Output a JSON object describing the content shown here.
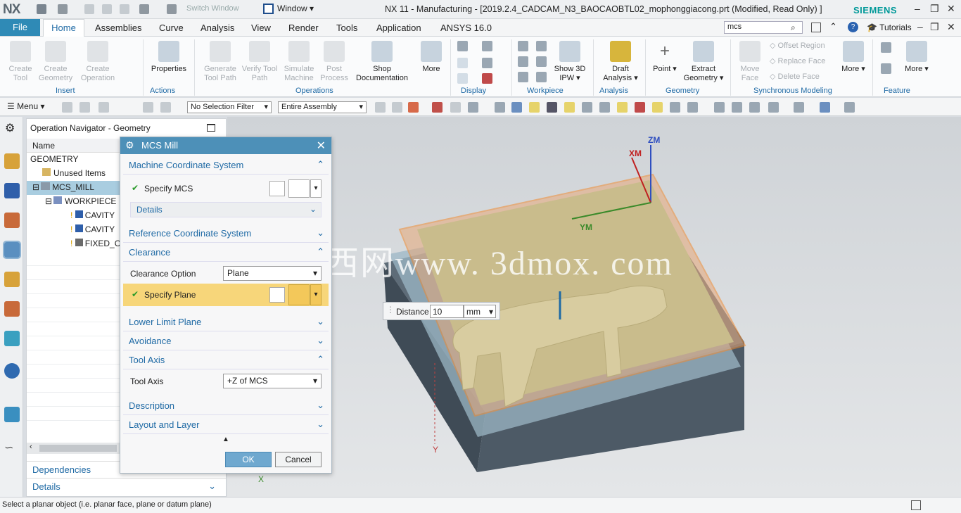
{
  "app": {
    "logo": "NX",
    "title": "NX 11 - Manufacturing - [2019.2.4_CADCAM_N3_BAOCAOBTL02_mophonggiacong.prt (Modified, Read Only) ]",
    "brand": "SIEMENS",
    "switch_window": "Switch Window",
    "window_menu": "Window"
  },
  "menu": {
    "file": "File",
    "tabs": [
      "Home",
      "Assemblies",
      "Curve",
      "Analysis",
      "View",
      "Render",
      "Tools",
      "Application",
      "ANSYS 16.0"
    ],
    "search": "mcs",
    "tutorials": "Tutorials"
  },
  "ribbon": {
    "buttons": [
      {
        "label": "Create Tool"
      },
      {
        "label": "Create Geometry"
      },
      {
        "label": "Create Operation"
      },
      {
        "label": "Properties"
      },
      {
        "label": "Generate Tool Path"
      },
      {
        "label": "Verify Tool Path"
      },
      {
        "label": "Simulate Machine"
      },
      {
        "label": "Post Process"
      },
      {
        "label": "Shop Documentation"
      },
      {
        "label": "More"
      },
      {
        "label": "Show 3D IPW"
      },
      {
        "label": "Draft Analysis"
      },
      {
        "label": "Point"
      },
      {
        "label": "Extract Geometry"
      },
      {
        "label": "Move Face"
      },
      {
        "label": "Offset Region"
      },
      {
        "label": "Replace Face"
      },
      {
        "label": "Delete Face"
      },
      {
        "label": "More"
      },
      {
        "label": "More"
      }
    ],
    "groups": [
      "Insert",
      "Actions",
      "Operations",
      "Display",
      "Workpiece",
      "Analysis",
      "Geometry",
      "Synchronous Modeling",
      "Feature"
    ]
  },
  "toolbar": {
    "menu": "Menu",
    "selection_filter": "No Selection Filter",
    "assembly": "Entire Assembly"
  },
  "navigator": {
    "title": "Operation Navigator - Geometry",
    "column": "Name",
    "items": [
      "GEOMETRY",
      "Unused Items",
      "MCS_MILL",
      "WORKPIECE",
      "CAVITY",
      "CAVITY",
      "FIXED_C"
    ],
    "dependencies": "Dependencies",
    "details": "Details"
  },
  "dialog": {
    "title": "MCS Mill",
    "sections": {
      "mcs": "Machine Coordinate System",
      "specify_mcs": "Specify MCS",
      "details": "Details",
      "rcs": "Reference Coordinate System",
      "clearance": "Clearance",
      "clearance_option_label": "Clearance Option",
      "clearance_option_value": "Plane",
      "specify_plane": "Specify Plane",
      "lower_limit": "Lower Limit Plane",
      "avoidance": "Avoidance",
      "tool_axis": "Tool Axis",
      "tool_axis_label": "Tool Axis",
      "tool_axis_value": "+Z of MCS",
      "description": "Description",
      "layout": "Layout and Layer"
    },
    "ok": "OK",
    "cancel": "Cancel"
  },
  "viewport": {
    "distance_label": "Distance",
    "distance_value": "10",
    "distance_unit": "mm",
    "axis_zm": "ZM",
    "axis_xm": "XM",
    "axis_ym": "YM",
    "axis_y": "Y",
    "axis_x": "X",
    "watermark": "莫西网www. 3dmox. com"
  },
  "status": "Select a planar object (i.e. planar face, plane or datum plane)"
}
